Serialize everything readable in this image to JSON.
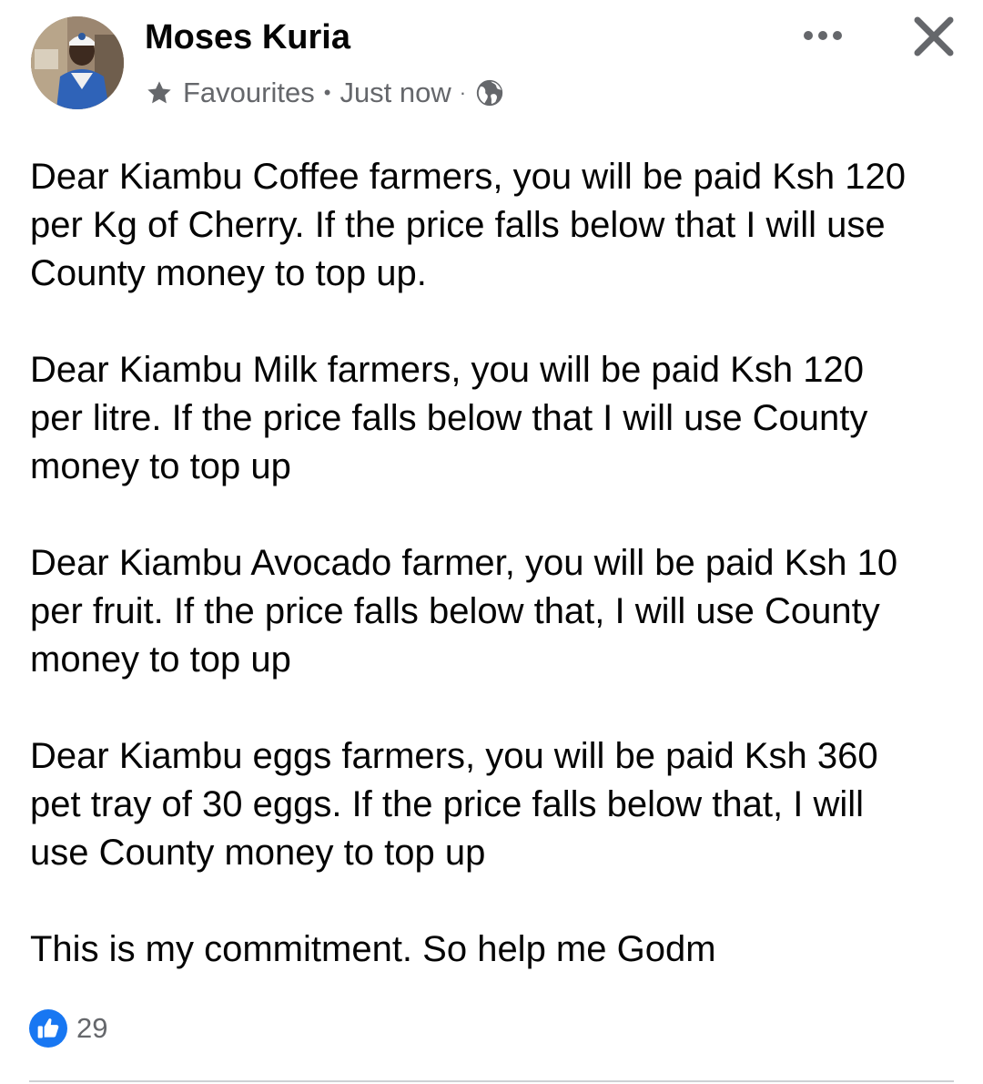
{
  "post": {
    "author": "Moses Kuria",
    "audience_label": "Favourites",
    "meta_separator": "•",
    "timestamp": "Just now",
    "privacy_separator": "·",
    "icons": {
      "audience": "star-icon",
      "privacy": "globe-icon",
      "more": "more-options-icon",
      "close": "close-icon",
      "reaction": "like-icon"
    },
    "paragraphs": [
      "Dear Kiambu Coffee farmers, you will be paid Ksh 120\nper Kg of Cherry. If the price falls below that I will use\nCounty money to top up.",
      "Dear Kiambu Milk farmers, you will be paid Ksh 120\nper litre. If the price falls below that I will use County\nmoney to top up",
      "Dear Kiambu Avocado farmer, you will be paid Ksh 10\nper fruit. If the price falls below that, I will use County\nmoney to top up",
      "Dear Kiambu eggs farmers, you will be paid Ksh 360\npet tray of 30 eggs. If the price falls below that, I will\nuse County money to top up",
      "This is my commitment.  So help me Godm"
    ],
    "reaction_count": "29"
  },
  "colors": {
    "text_primary": "#050505",
    "text_secondary": "#65676b",
    "like_blue": "#1877f2",
    "divider": "#ced0d4"
  }
}
